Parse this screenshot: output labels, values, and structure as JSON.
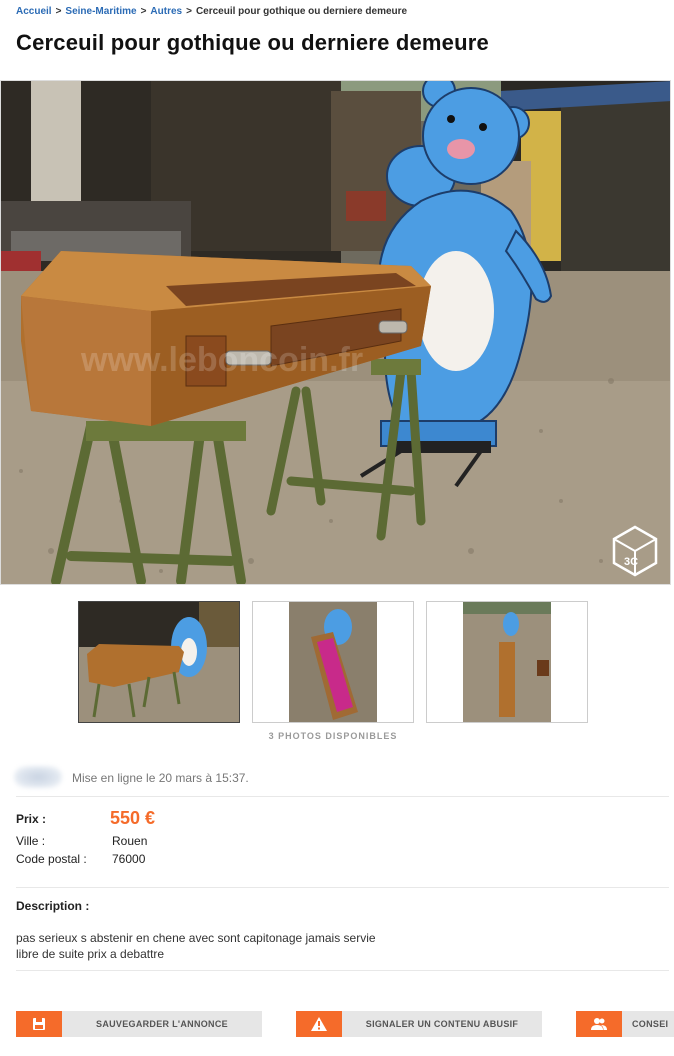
{
  "breadcrumb": {
    "items": [
      "Accueil",
      "Seine-Maritime",
      "Autres"
    ],
    "separator": ">",
    "current": "Cerceuil pour gothique ou derniere demeure"
  },
  "title": "Cerceuil pour gothique ou derniere demeure",
  "photos": {
    "watermark_logo": "3C",
    "watermark_text": "www.leboncoin.fr",
    "count_label": "3 PHOTOS DISPONIBLES"
  },
  "listing": {
    "posted": "Mise en ligne le 20 mars à 15:37.",
    "price_label": "Prix :",
    "price": "550 €",
    "city_label": "Ville :",
    "city": "Rouen",
    "postal_label": "Code postal :",
    "postal": "76000",
    "description_label": "Description :",
    "description_lines": [
      "pas serieux s abstenir en chene avec sont capitonage jamais servie",
      "libre de suite prix a debattre"
    ]
  },
  "actions": {
    "save": "SAUVEGARDER L'ANNONCE",
    "report": "SIGNALER UN CONTENU ABUSIF",
    "advice": "CONSEI"
  },
  "colors": {
    "accent": "#f56b2a",
    "link": "#2b6bb5",
    "button_bg": "#e6e6e6"
  }
}
